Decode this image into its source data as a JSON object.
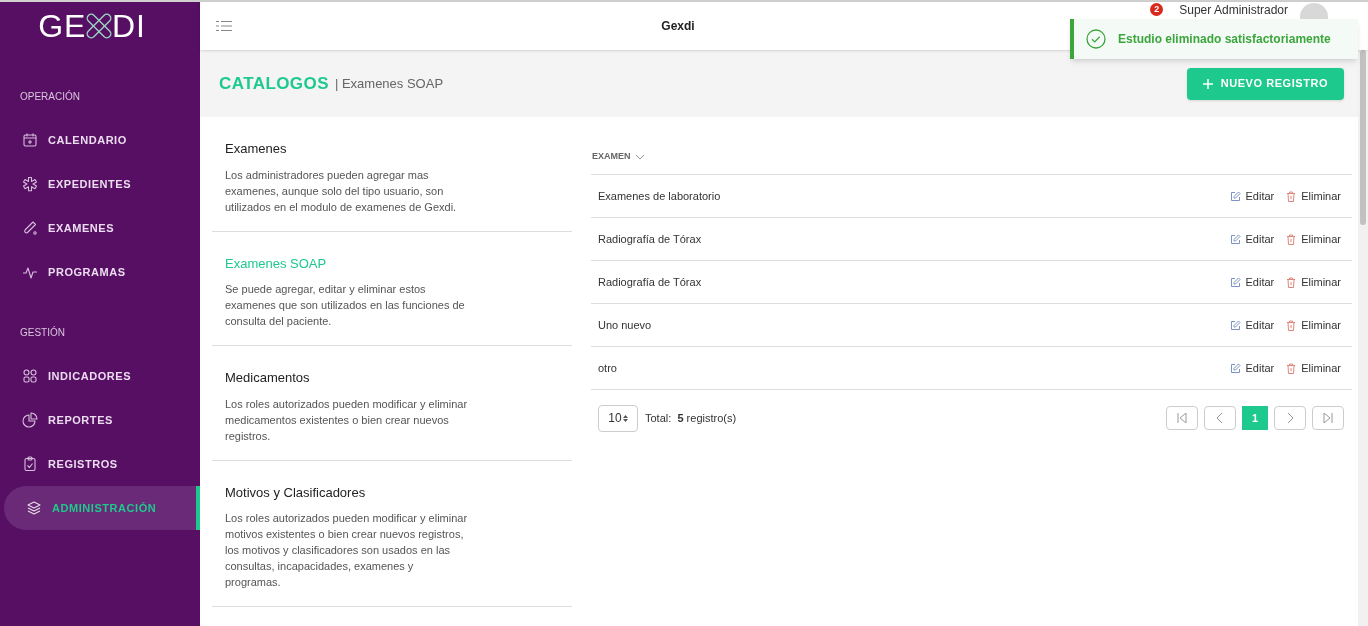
{
  "logo": {
    "left": "GE",
    "right": "DI"
  },
  "sidebar": {
    "sections": [
      {
        "title": "OPERACIÓN",
        "items": [
          {
            "label": "CALENDARIO",
            "selected": false
          },
          {
            "label": "EXPEDIENTES",
            "selected": false
          },
          {
            "label": "EXAMENES",
            "selected": false
          },
          {
            "label": "PROGRAMAS",
            "selected": false
          }
        ]
      },
      {
        "title": "GESTIÓN",
        "items": [
          {
            "label": "INDICADORES",
            "selected": false
          },
          {
            "label": "REPORTES",
            "selected": false
          },
          {
            "label": "REGISTROS",
            "selected": false
          },
          {
            "label": "ADMINISTRACIÓN",
            "selected": true
          }
        ]
      }
    ]
  },
  "header": {
    "title": "Gexdi",
    "notifications": "2",
    "user": "Super Administrador"
  },
  "toast": {
    "message": "Estudio eliminado satisfactoriamente"
  },
  "page": {
    "title": "CATALOGOS",
    "subtitle": "| Examenes SOAP",
    "new_button": "NUEVO REGISTRO"
  },
  "catalogs": [
    {
      "title": "Examenes",
      "description": "Los administradores pueden agregar mas examenes, aunque solo del tipo usuario, son utilizados en el modulo de examenes de Gexdi.",
      "selected": false
    },
    {
      "title": "Examenes SOAP",
      "description": "Se puede agregar, editar y eliminar estos examenes que son utilizados en las funciones de consulta del paciente.",
      "selected": true
    },
    {
      "title": "Medicamentos",
      "description": "Los roles autorizados pueden modificar y eliminar medicamentos existentes o bien crear nuevos registros.",
      "selected": false
    },
    {
      "title": "Motivos y Clasificadores",
      "description": "Los roles autorizados pueden modificar y eliminar motivos existentes o bien crear nuevos registros, los motivos y clasificadores son usados en las consultas, incapacidades, examenes y programas.",
      "selected": false
    }
  ],
  "table": {
    "column": "EXAMEN",
    "rows": [
      {
        "name": "Examenes de laboratorio",
        "edit": "Editar",
        "delete": "Eliminar"
      },
      {
        "name": "Radiografía de Tórax",
        "edit": "Editar",
        "delete": "Eliminar"
      },
      {
        "name": "Radiografía de Tórax",
        "edit": "Editar",
        "delete": "Eliminar"
      },
      {
        "name": "Uno nuevo",
        "edit": "Editar",
        "delete": "Eliminar"
      },
      {
        "name": "otro",
        "edit": "Editar",
        "delete": "Eliminar"
      }
    ]
  },
  "pagination": {
    "page_size": "10",
    "total_label": "Total:",
    "total": "5",
    "total_unit": "registro(s)",
    "pages": [
      {
        "label": "1",
        "selected": true
      }
    ]
  }
}
